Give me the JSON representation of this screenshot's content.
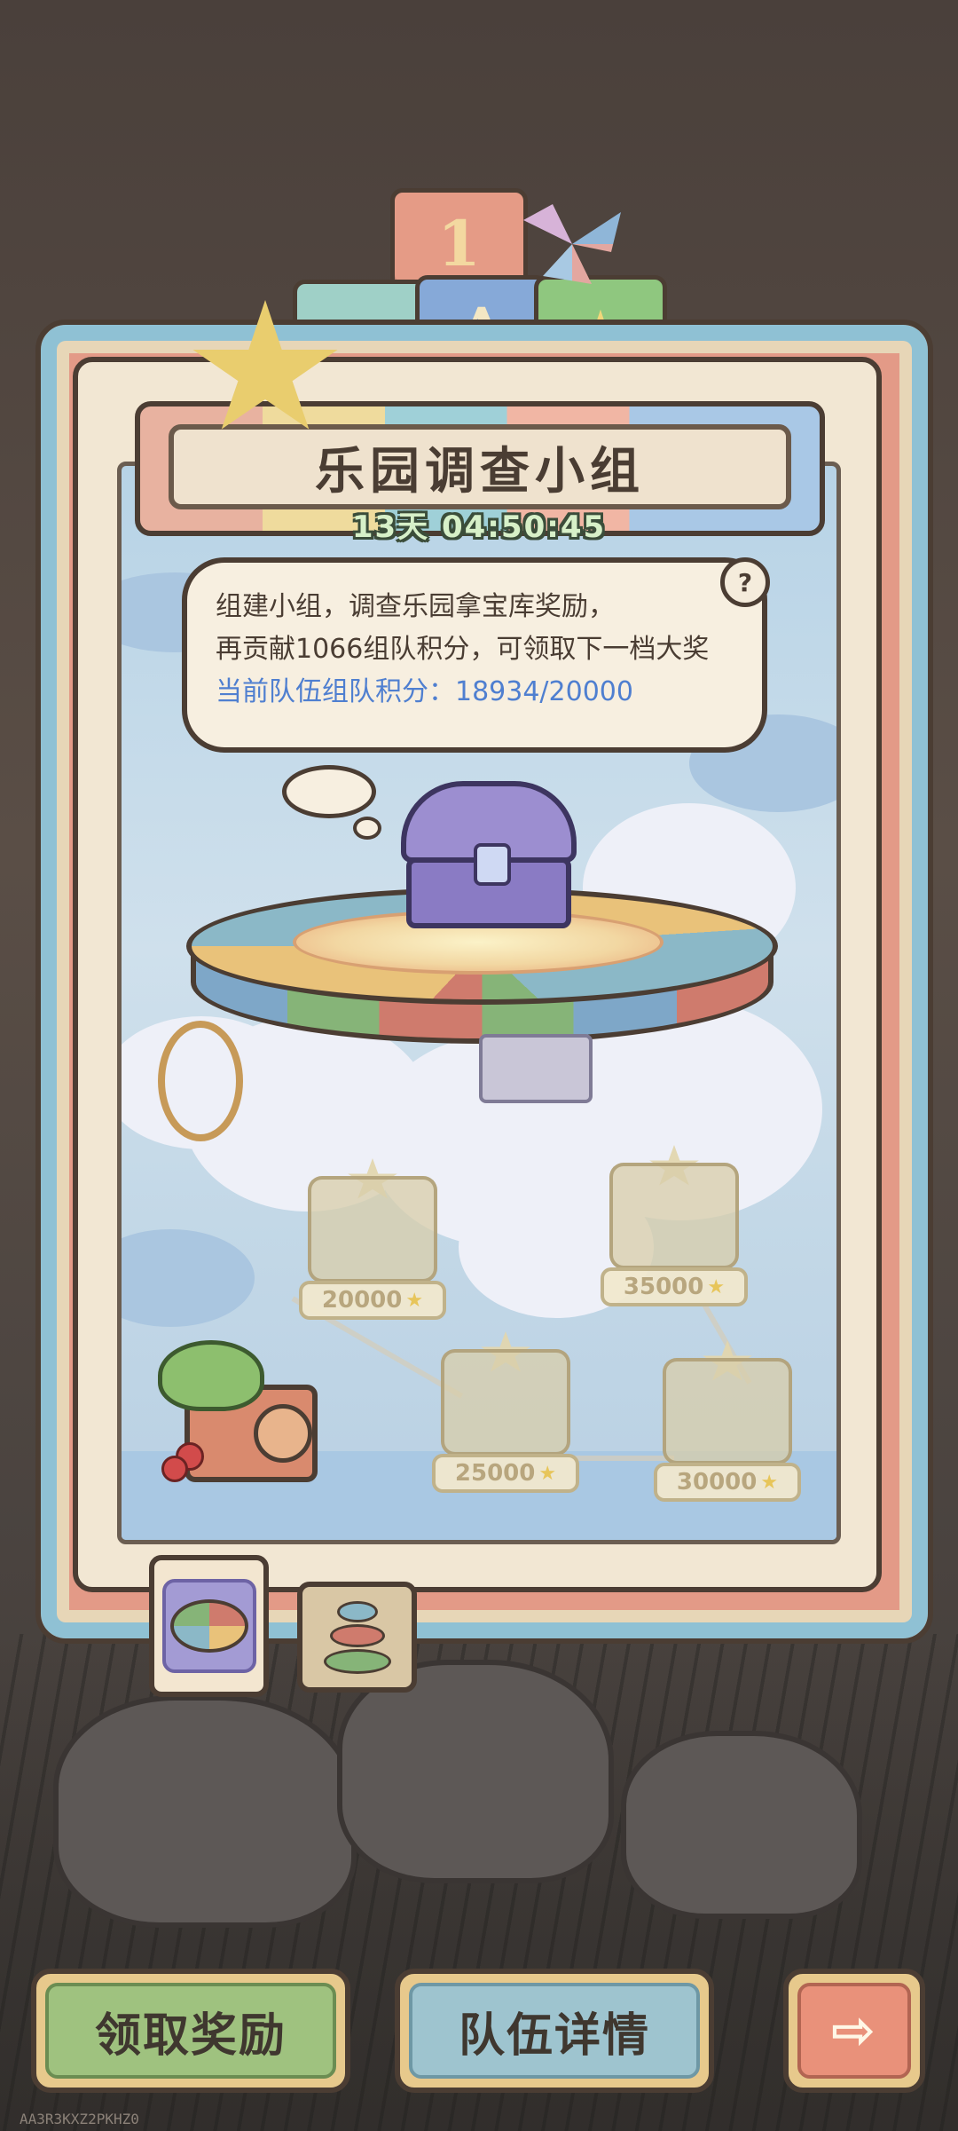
{
  "title": "乐园调查小组",
  "timer": "13天 04:50:45",
  "blocks": {
    "top_left": "1",
    "middle": "A"
  },
  "bubble": {
    "line1": "组建小组，调查乐园拿宝库奖励，",
    "line2": "再贡献1066组队积分，可领取下一档大奖",
    "score_label": "当前队伍组队积分：",
    "score_value": "18934/20000",
    "help_label": "?"
  },
  "progress": {
    "current": 18934,
    "target": 20000
  },
  "milestones": [
    {
      "value": "20000",
      "icon": "star-icon"
    },
    {
      "value": "35000",
      "icon": "star-icon"
    },
    {
      "value": "25000",
      "icon": "star-icon"
    },
    {
      "value": "30000",
      "icon": "star-icon"
    }
  ],
  "tabs": [
    {
      "name": "platform-tab",
      "icon": "carousel-platform-icon",
      "active": true
    },
    {
      "name": "stack-tab",
      "icon": "stacked-rings-icon",
      "active": false
    }
  ],
  "buttons": {
    "claim": "领取奖励",
    "team": "队伍详情",
    "next": "⇨"
  },
  "watermark": "AA3R3KXZ2PKHZ0",
  "colors": {
    "accent_blue": "#4f7fd0",
    "claim_green": "#9fc27f",
    "team_blue": "#9ec4cf",
    "next_coral": "#e9917a"
  }
}
